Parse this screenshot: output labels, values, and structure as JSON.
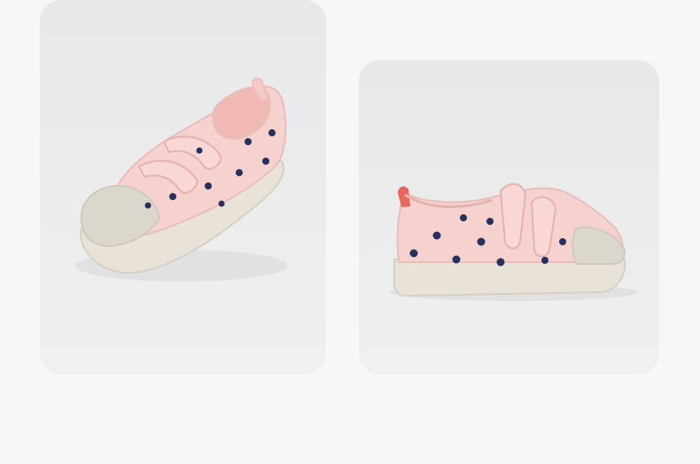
{
  "gallery": {
    "images": [
      {
        "subject": "shoe-three-quarter-view",
        "colors": {
          "upper": "#f6d2cf",
          "dots": "#27305e",
          "sole": "#e8e2d8",
          "toe_cap": "#dcd7cd",
          "lining": "#f0b9b4"
        }
      },
      {
        "subject": "shoe-side-view",
        "colors": {
          "upper": "#f6d2cf",
          "dots": "#27305e",
          "sole": "#e8e2d8",
          "toe_cap": "#dcd7cd",
          "heel_tab": "#e8675c"
        }
      }
    ],
    "background_color": "#f7f7f7",
    "card_color": "#ebebed"
  }
}
